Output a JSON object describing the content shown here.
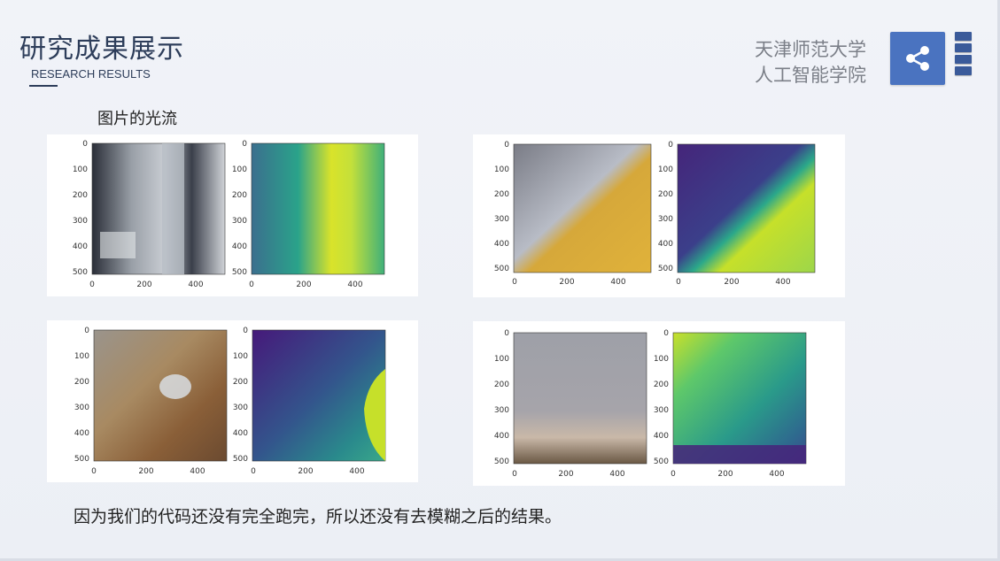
{
  "header": {
    "title": "研究成果展示",
    "subtitle": "RESEARCH RESULTS",
    "university_line1": "天津师范大学",
    "university_line2": "人工智能学院"
  },
  "section_label": "图片的光流",
  "footnote": "因为我们的代码还没有完全跑完，所以还没有去模糊之后的结果。",
  "axes": {
    "y_ticks": [
      "0",
      "100",
      "200",
      "300",
      "400",
      "500"
    ],
    "x_ticks": [
      "0",
      "200",
      "400"
    ]
  },
  "panels": [
    {
      "name": "panel-top-left",
      "input": "blurred street scene",
      "flow": "viridis flow map"
    },
    {
      "name": "panel-top-right",
      "input": "blurred yellow diagonal scene",
      "flow": "viridis flow map"
    },
    {
      "name": "panel-bottom-left",
      "input": "blurred basket scene",
      "flow": "viridis flow map"
    },
    {
      "name": "panel-bottom-right",
      "input": "blurred sky scene",
      "flow": "viridis flow map"
    }
  ],
  "colors": {
    "title": "#2d3d5a",
    "share_button": "#4a73c0",
    "bars": "#3a5a9a"
  },
  "icons": [
    "share-icon"
  ]
}
